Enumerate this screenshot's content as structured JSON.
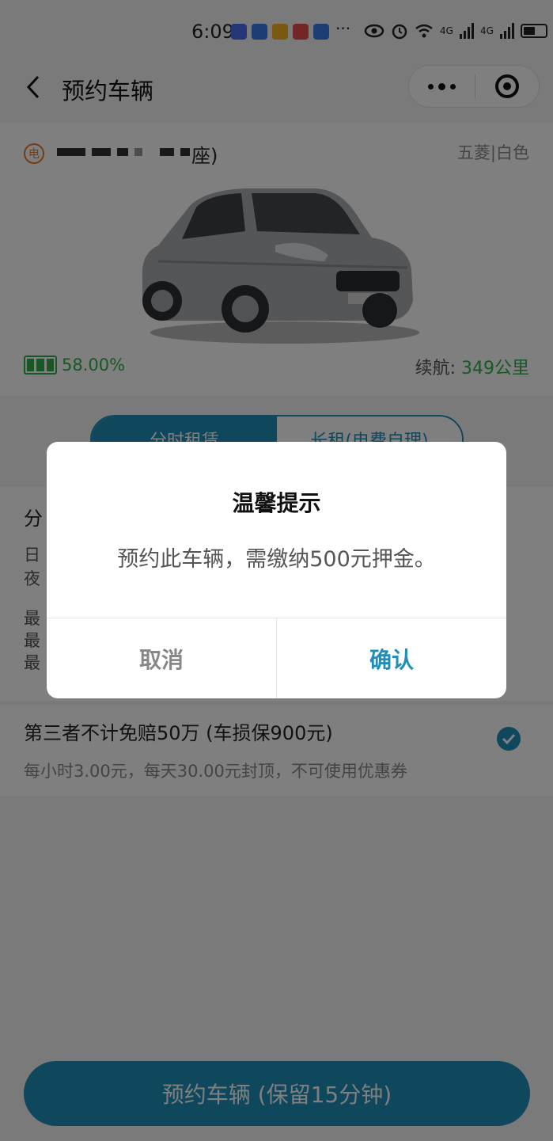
{
  "status_bar": {
    "time": "6:09",
    "more_indicator": "···",
    "signal_1": "4G",
    "signal_2": "4G"
  },
  "nav": {
    "title": "预约车辆"
  },
  "car": {
    "ev_badge": "电",
    "seat_suffix": "座)",
    "brand_color": "五菱|白色",
    "battery_percent": "58.00%",
    "range_label": "续航:",
    "range_value": "349公里"
  },
  "tabs": [
    {
      "label": "分时租赁",
      "active": true
    },
    {
      "label": "长租(电费自理)",
      "active": false
    }
  ],
  "pricing": {
    "title": "分",
    "line1": "日",
    "line2": "夜",
    "line3": "最",
    "line4": "最",
    "line5": "最"
  },
  "insurance": {
    "title": "第三者不计免赔50万 (车损保900元)",
    "subtitle": "每小时3.00元，每天30.00元封顶，不可使用优惠券",
    "checked": true
  },
  "bottom_button": {
    "label": "预约车辆 (保留15分钟)"
  },
  "dialog": {
    "title": "温馨提示",
    "message": "预约此车辆，需缴纳500元押金。",
    "cancel_label": "取消",
    "confirm_label": "确认"
  },
  "colors": {
    "accent": "#1f8fb8",
    "battery_green": "#2fb04a",
    "ev_orange": "#e57a2a"
  }
}
